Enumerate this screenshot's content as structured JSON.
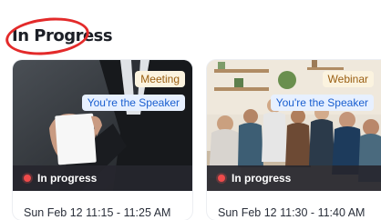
{
  "section": {
    "title": "In Progress"
  },
  "cards": [
    {
      "type_badge": "Meeting",
      "role_badge": "You're the Speaker",
      "status": "In progress",
      "time": "Sun Feb 12 11:15 - 11:25 AM"
    },
    {
      "type_badge": "Webinar",
      "role_badge": "You're the Speaker",
      "status": "In progress",
      "time": "Sun Feb 12 11:30 - 11:40 AM"
    }
  ],
  "colors": {
    "status_dot": "#ef4b4b",
    "highlight_ring": "#e32a2a",
    "type_badge_text": "#9a5f12",
    "role_badge_text": "#1a5fd0"
  },
  "icons": [
    "status-dot-icon"
  ]
}
